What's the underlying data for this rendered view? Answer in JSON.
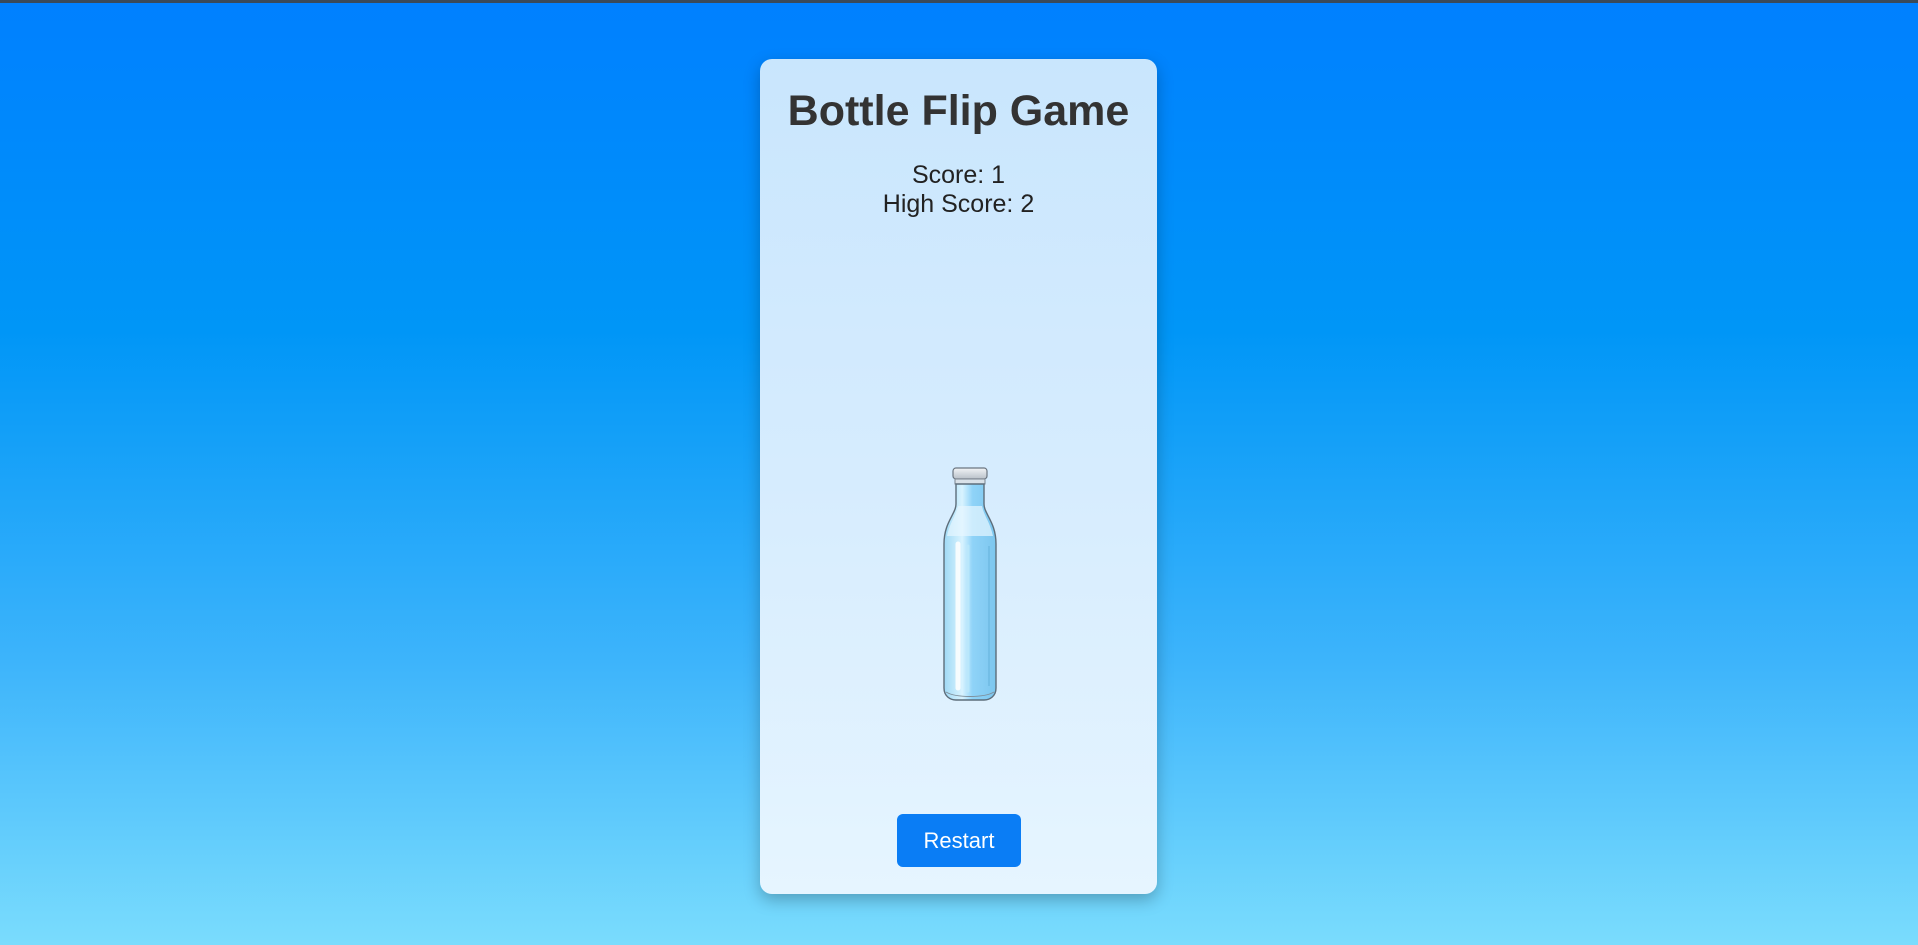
{
  "game": {
    "title": "Bottle Flip Game",
    "score_label": "Score: 1",
    "high_score_label": "High Score: 2",
    "restart_label": "Restart"
  },
  "colors": {
    "background_top": "#0080ff",
    "background_bottom": "#7adcfd",
    "card": "#d6ecfe",
    "button": "#0a7df5",
    "title_text": "#333333"
  },
  "icons": {
    "bottle": "water-bottle-icon"
  }
}
